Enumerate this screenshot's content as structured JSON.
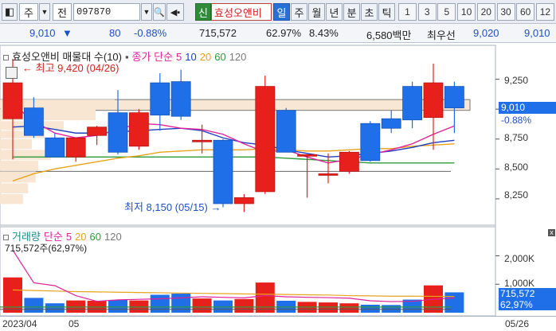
{
  "toolbar": {
    "market": "주",
    "type_label": "전",
    "stock_code": "097870",
    "stock_name": "효성오앤비",
    "stock_tag": "신",
    "periods": [
      "일",
      "주",
      "월",
      "년",
      "분",
      "초",
      "틱"
    ],
    "selected_period": "일",
    "intervals": [
      "1",
      "3",
      "5",
      "10",
      "20",
      "30",
      "60",
      "12"
    ]
  },
  "quote": {
    "price": "9,010",
    "direction": "▼",
    "change": "80",
    "change_pct": "-0.88%",
    "volume": "715,572",
    "vol_ratio": "62.97%",
    "turnover": "8.43%",
    "amount": "6,580백만",
    "ask_label": "최우선",
    "ask_price": "9,020",
    "bid_price": "9,010"
  },
  "price_panel": {
    "title": "효성오앤비 매물대 수(10)",
    "ma_label": "종가 단순",
    "ma_periods": [
      "5",
      "10",
      "20",
      "60",
      "120"
    ],
    "high_note": "최고 9,420 (04/26)",
    "low_note": "최저 8,150 (05/15)",
    "y_labels": [
      "9,250",
      "9,000",
      "8,750",
      "8,500",
      "8,250"
    ],
    "current_price_tag": "9,010",
    "current_pct_tag": "-0.88%"
  },
  "volume_panel": {
    "title": "거래량",
    "ma_label": "단순",
    "ma_periods": [
      "5",
      "20",
      "60",
      "120"
    ],
    "info": "715,572주(62,97%)",
    "y_labels": [
      "2,000K",
      "1,000K"
    ],
    "volume_tag": "715,572",
    "ratio_tag": "62,97%"
  },
  "x_axis": {
    "labels": [
      "2023/04",
      "05",
      "05/26"
    ]
  },
  "colors": {
    "up": "#e8201c",
    "down": "#1f6fe8",
    "ma5": "#e0219a",
    "ma10": "#1f3fbf",
    "ma20": "#e8a21c",
    "ma60": "#2c9a3c",
    "ma120": "#7a7a7a"
  },
  "chart_data": {
    "type": "candlestick",
    "candles": [
      {
        "o": 8920,
        "h": 9420,
        "l": 8580,
        "c": 9220
      },
      {
        "o": 9010,
        "h": 9100,
        "l": 8760,
        "c": 8780
      },
      {
        "o": 8760,
        "h": 8800,
        "l": 8620,
        "c": 8600
      },
      {
        "o": 8600,
        "h": 8750,
        "l": 8560,
        "c": 8760
      },
      {
        "o": 8780,
        "h": 8860,
        "l": 8700,
        "c": 8850
      },
      {
        "o": 8970,
        "h": 9160,
        "l": 8620,
        "c": 8640
      },
      {
        "o": 8690,
        "h": 9000,
        "l": 8660,
        "c": 8970
      },
      {
        "o": 9220,
        "h": 9300,
        "l": 8820,
        "c": 8950
      },
      {
        "o": 9230,
        "h": 9330,
        "l": 8910,
        "c": 8940
      },
      {
        "o": 8740,
        "h": 8870,
        "l": 8630,
        "c": 8740
      },
      {
        "o": 8740,
        "h": 8750,
        "l": 8180,
        "c": 8210
      },
      {
        "o": 8210,
        "h": 8290,
        "l": 8140,
        "c": 8260
      },
      {
        "o": 8310,
        "h": 9280,
        "l": 8290,
        "c": 9190
      },
      {
        "o": 8990,
        "h": 9010,
        "l": 8760,
        "c": 8640
      },
      {
        "o": 8620,
        "h": 8620,
        "l": 8260,
        "c": 8620
      },
      {
        "o": 8450,
        "h": 8630,
        "l": 8380,
        "c": 8460
      },
      {
        "o": 8480,
        "h": 8650,
        "l": 8460,
        "c": 8640
      },
      {
        "o": 8880,
        "h": 8900,
        "l": 8560,
        "c": 8570
      },
      {
        "o": 8920,
        "h": 8990,
        "l": 8800,
        "c": 8840
      },
      {
        "o": 9190,
        "h": 9230,
        "l": 8840,
        "c": 8910
      },
      {
        "o": 8930,
        "h": 9380,
        "l": 8660,
        "c": 9220
      },
      {
        "o": 9190,
        "h": 9230,
        "l": 8800,
        "c": 9010
      }
    ],
    "ma5": [
      9040,
      8900,
      8800,
      8760,
      8780,
      8830,
      8880,
      8870,
      8840,
      8830,
      8790,
      8710,
      8640,
      8660,
      8600,
      8550,
      8580,
      8620,
      8660,
      8710,
      8790,
      8860
    ],
    "ma10": [
      8850,
      8860,
      8830,
      8800,
      8800,
      8810,
      8820,
      8830,
      8840,
      8820,
      8760,
      8720,
      8700,
      8660,
      8630,
      8600,
      8610,
      8630,
      8650,
      8680,
      8720,
      8740
    ],
    "ma20": [
      8400,
      8460,
      8500,
      8530,
      8560,
      8590,
      8610,
      8640,
      8650,
      8660,
      8660,
      8660,
      8670,
      8660,
      8650,
      8650,
      8660,
      8670,
      8670,
      8690,
      8700,
      8710
    ],
    "ma60": [
      8600,
      8600,
      8600,
      8600,
      8600,
      8600,
      8600,
      8600,
      8600,
      8600,
      8600,
      8600,
      8600,
      8590,
      8580,
      8570,
      8560,
      8550,
      8550,
      8550,
      8550,
      8550
    ],
    "volumes": [
      1240,
      520,
      330,
      430,
      420,
      450,
      430,
      630,
      670,
      500,
      430,
      480,
      1060,
      420,
      380,
      360,
      330,
      280,
      270,
      460,
      960,
      715
    ],
    "vol_ma5": [
      2200,
      1050,
      950,
      600,
      400,
      450,
      470,
      490,
      520,
      560,
      540,
      520,
      600,
      560,
      540,
      530,
      510,
      420,
      390,
      400,
      470,
      520
    ],
    "vol_ma20": [
      800,
      780,
      760,
      740,
      730,
      720,
      710,
      700,
      690,
      680,
      670,
      660,
      650,
      640,
      630,
      620,
      600,
      590,
      580,
      580,
      575,
      570
    ],
    "price_ylim": [
      8050,
      9500
    ],
    "vol_ylim": [
      0,
      2600
    ]
  }
}
